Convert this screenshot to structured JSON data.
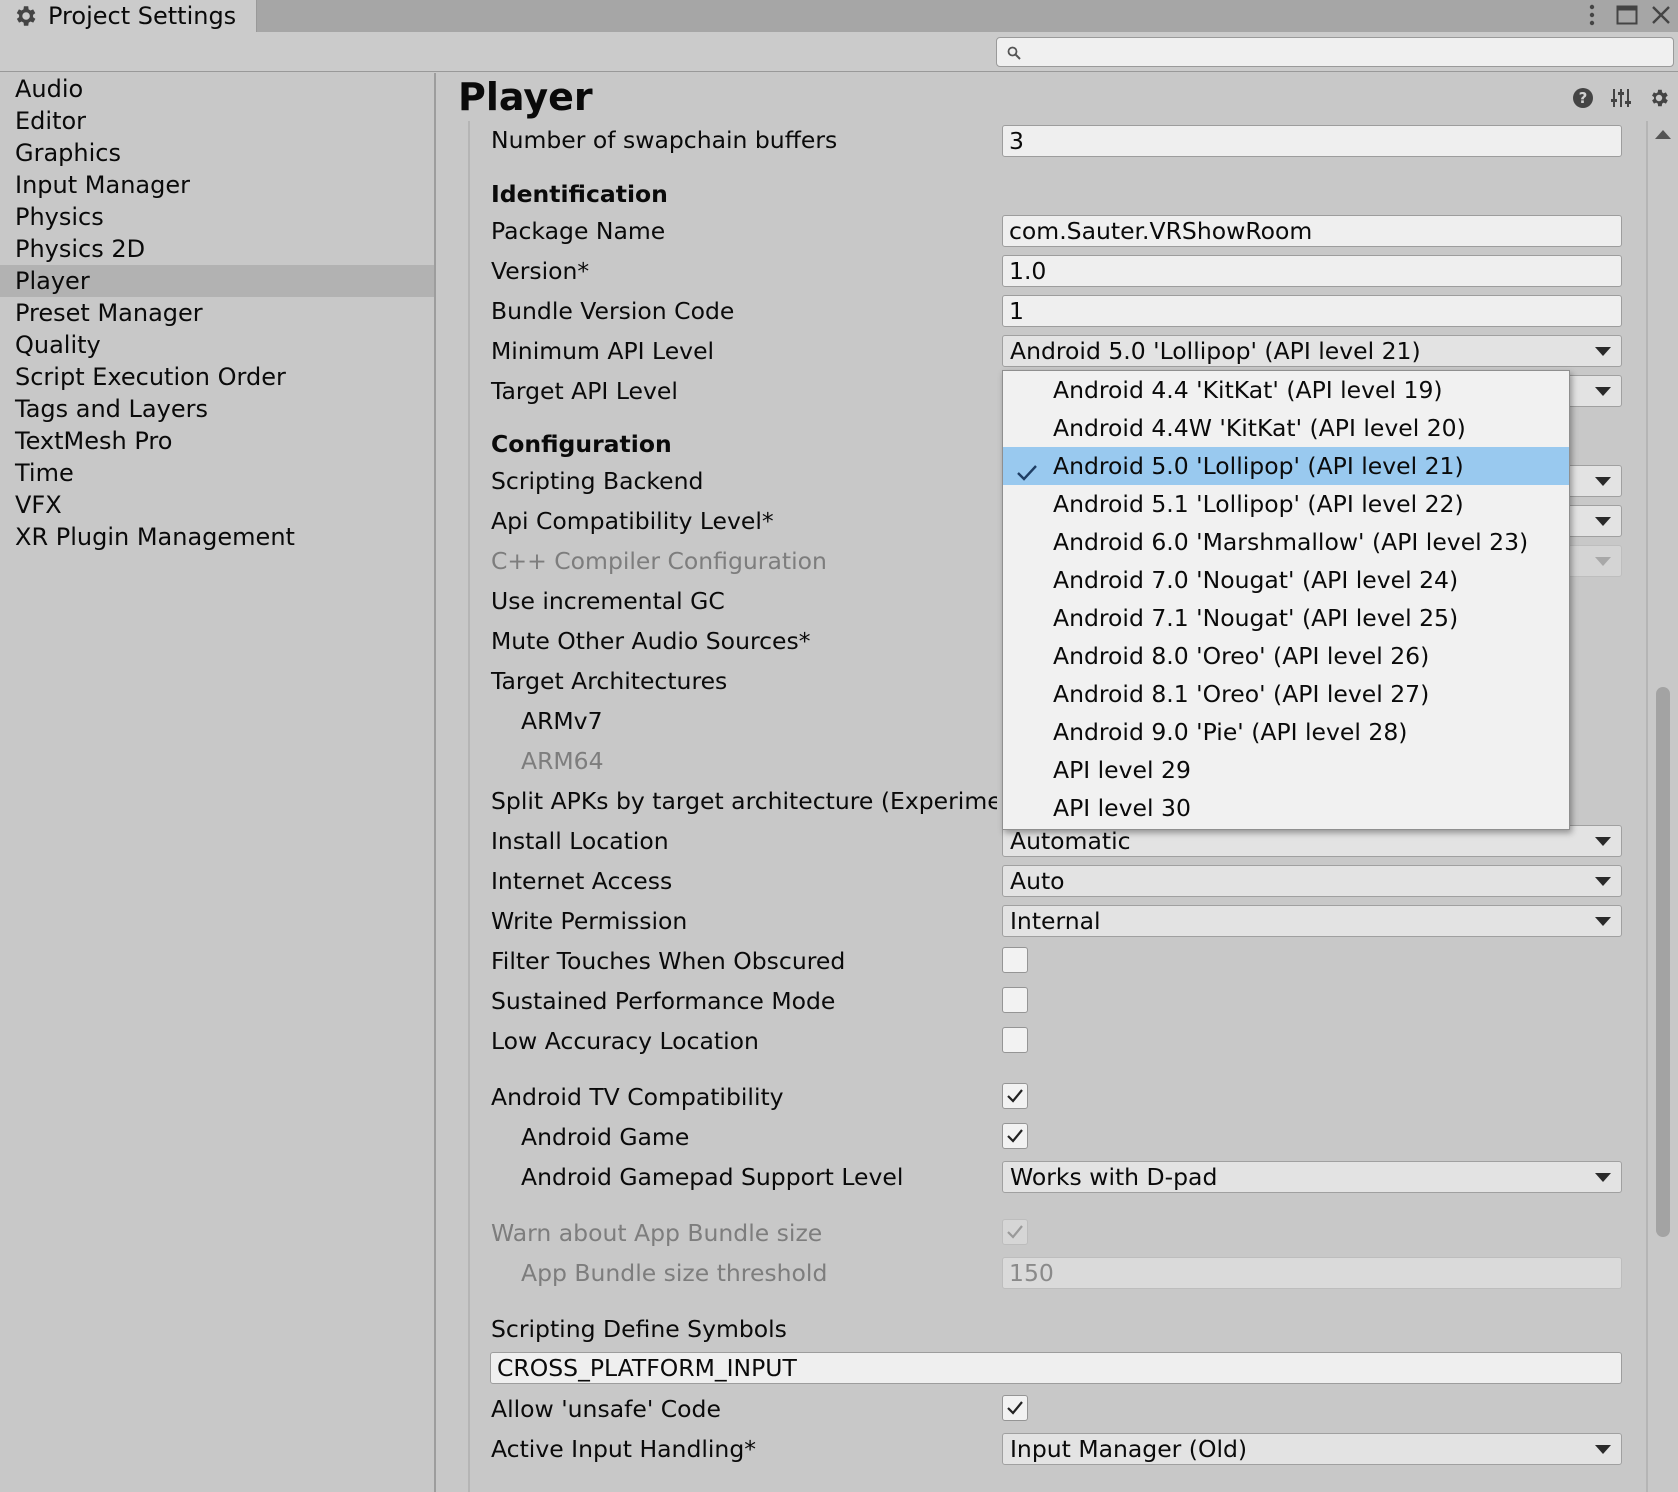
{
  "window": {
    "tab_title": "Project Settings",
    "icons": {
      "tab": "gear-icon",
      "menu": "kebab-menu-icon",
      "maximize": "maximize-icon",
      "close": "close-icon",
      "search": "search-icon"
    }
  },
  "search": {
    "value": "",
    "placeholder": ""
  },
  "sidebar": {
    "items": [
      "Audio",
      "Editor",
      "Graphics",
      "Input Manager",
      "Physics",
      "Physics 2D",
      "Player",
      "Preset Manager",
      "Quality",
      "Script Execution Order",
      "Tags and Layers",
      "TextMesh Pro",
      "Time",
      "VFX",
      "XR Plugin Management"
    ],
    "selected": "Player"
  },
  "main": {
    "title": "Player",
    "header_icons": [
      "help-icon",
      "preset-sliders-icon",
      "settings-gear-icon"
    ]
  },
  "settings": {
    "swapchain": {
      "label": "Number of swapchain buffers",
      "value": "3"
    },
    "identification": {
      "heading": "Identification",
      "package_name": {
        "label": "Package Name",
        "value": "com.Sauter.VRShowRoom"
      },
      "version": {
        "label": "Version*",
        "value": "1.0"
      },
      "bundle_version_code": {
        "label": "Bundle Version Code",
        "value": "1"
      },
      "min_api": {
        "label": "Minimum API Level",
        "value": "Android 5.0 'Lollipop' (API level 21)"
      },
      "target_api": {
        "label": "Target API Level"
      }
    },
    "configuration": {
      "heading": "Configuration",
      "scripting_backend": {
        "label": "Scripting Backend"
      },
      "api_compat": {
        "label": "Api Compatibility Level*"
      },
      "cpp_compiler": {
        "label": "C++ Compiler Configuration"
      },
      "incremental_gc": {
        "label": "Use incremental GC"
      },
      "mute_audio": {
        "label": "Mute Other Audio Sources*"
      },
      "target_arch": {
        "label": "Target Architectures"
      },
      "armv7": {
        "label": "ARMv7"
      },
      "arm64": {
        "label": "ARM64"
      },
      "split_apks": {
        "label": "Split APKs by target architecture (Experimenta"
      },
      "install_location": {
        "label": "Install Location",
        "value": "Automatic"
      },
      "internet_access": {
        "label": "Internet Access",
        "value": "Auto"
      },
      "write_permission": {
        "label": "Write Permission",
        "value": "Internal"
      },
      "filter_touches": {
        "label": "Filter Touches When Obscured",
        "checked": false
      },
      "sustained_perf": {
        "label": "Sustained Performance Mode",
        "checked": false
      },
      "low_accuracy": {
        "label": "Low Accuracy Location",
        "checked": false
      },
      "android_tv": {
        "label": "Android TV Compatibility",
        "checked": true
      },
      "android_game": {
        "label": "Android Game",
        "checked": true
      },
      "gamepad_level": {
        "label": "Android Gamepad Support Level",
        "value": "Works with D-pad"
      },
      "warn_bundle": {
        "label": "Warn about App Bundle size",
        "checked": true
      },
      "bundle_threshold": {
        "label": "App Bundle size threshold",
        "value": "150"
      },
      "define_symbols": {
        "label": "Scripting Define Symbols",
        "value": "CROSS_PLATFORM_INPUT"
      },
      "unsafe_code": {
        "label": "Allow 'unsafe' Code",
        "checked": true
      },
      "input_handling": {
        "label": "Active Input Handling*",
        "value": "Input Manager (Old)"
      }
    }
  },
  "api_popup": {
    "options": [
      "Android 4.4 'KitKat' (API level 19)",
      "Android 4.4W 'KitKat' (API level 20)",
      "Android 5.0 'Lollipop' (API level 21)",
      "Android 5.1 'Lollipop' (API level 22)",
      "Android 6.0 'Marshmallow' (API level 23)",
      "Android 7.0 'Nougat' (API level 24)",
      "Android 7.1 'Nougat' (API level 25)",
      "Android 8.0 'Oreo' (API level 26)",
      "Android 8.1 'Oreo' (API level 27)",
      "Android 9.0 'Pie' (API level 28)",
      "API level 29",
      "API level 30"
    ],
    "selected": "Android 5.0 'Lollipop' (API level 21)"
  },
  "colors": {
    "selection": "#99c9ef",
    "panel": "#c8c8c8",
    "titlebar": "#a6a6a6"
  }
}
